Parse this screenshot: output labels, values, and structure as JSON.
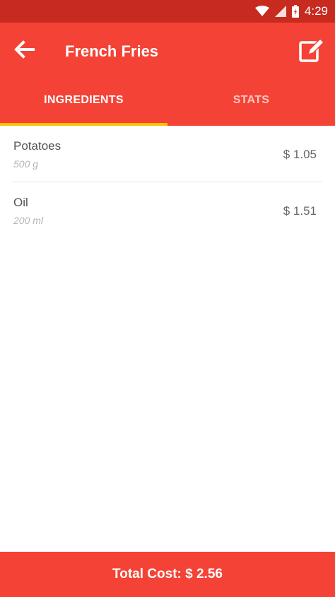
{
  "status_bar": {
    "time": "4:29",
    "icons": [
      "wifi-icon",
      "signal-icon",
      "battery-icon"
    ]
  },
  "header": {
    "title": "French Fries",
    "back_icon": "arrow-back-icon",
    "edit_icon": "edit-icon"
  },
  "tabs": [
    {
      "label": "INGREDIENTS",
      "active": true
    },
    {
      "label": "STATS",
      "active": false
    }
  ],
  "ingredients": [
    {
      "name": "Potatoes",
      "quantity": "500 g",
      "price": "$ 1.05"
    },
    {
      "name": "Oil",
      "quantity": "200 ml",
      "price": "$ 1.51"
    }
  ],
  "footer": {
    "total_label": "Total Cost: $ 2.56"
  },
  "colors": {
    "primary": "#f44336",
    "primary_dark": "#c72a1f",
    "tab_indicator": "#ffc107"
  }
}
